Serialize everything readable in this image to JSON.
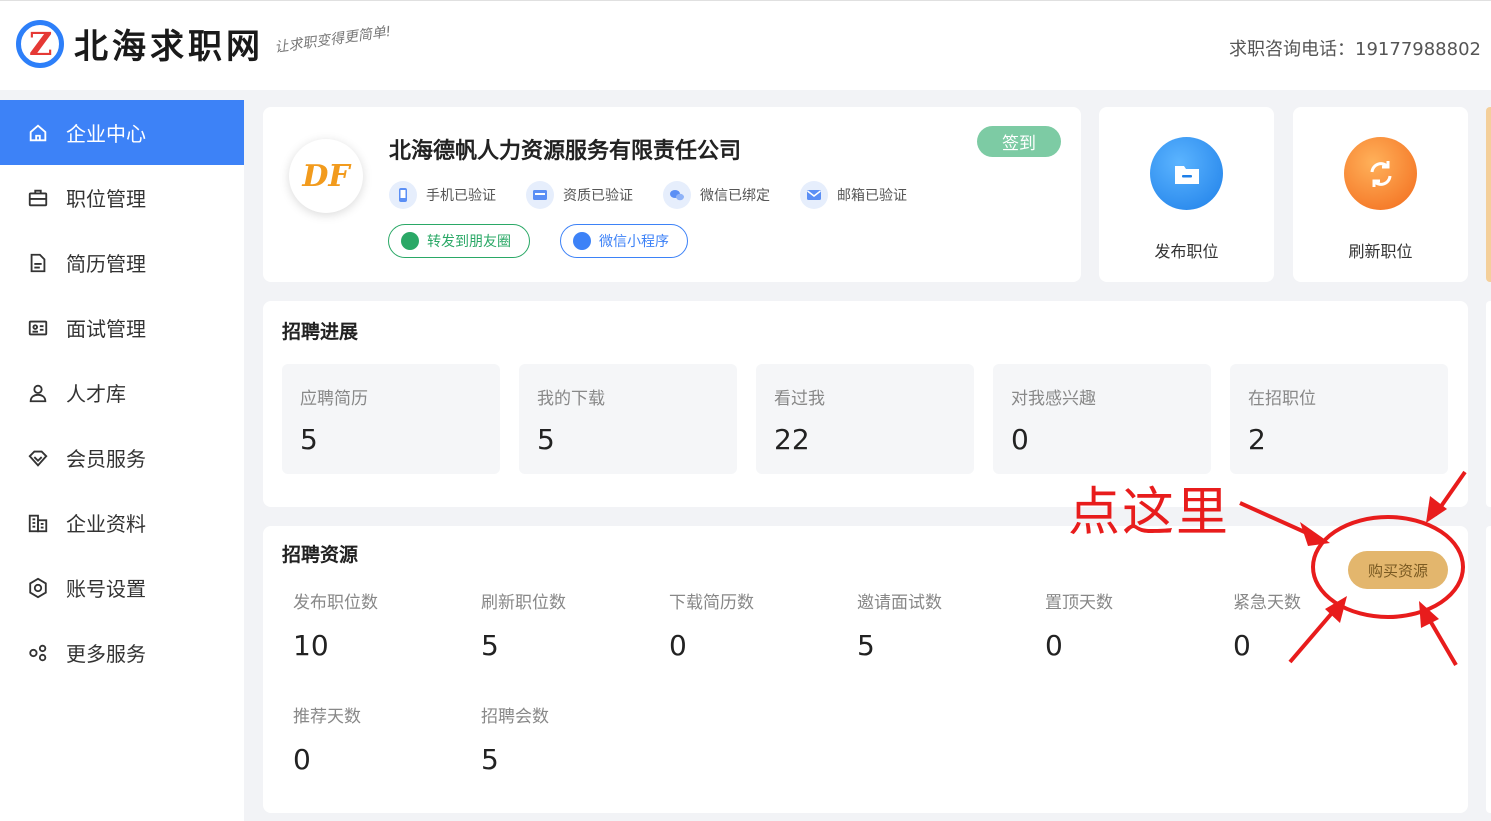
{
  "header": {
    "site_name": "北海求职网",
    "slogan": "让求职变得更简单!",
    "hotline": "求职咨询电话：19177988802"
  },
  "sidebar": {
    "items": [
      {
        "label": "企业中心",
        "icon": "home-icon",
        "active": true
      },
      {
        "label": "职位管理",
        "icon": "briefcase-icon",
        "active": false
      },
      {
        "label": "简历管理",
        "icon": "document-icon",
        "active": false
      },
      {
        "label": "面试管理",
        "icon": "id-card-icon",
        "active": false
      },
      {
        "label": "人才库",
        "icon": "user-icon",
        "active": false
      },
      {
        "label": "会员服务",
        "icon": "diamond-icon",
        "active": false
      },
      {
        "label": "企业资料",
        "icon": "building-icon",
        "active": false
      },
      {
        "label": "账号设置",
        "icon": "settings-icon",
        "active": false
      },
      {
        "label": "更多服务",
        "icon": "apps-icon",
        "active": false
      }
    ]
  },
  "company": {
    "logo_text": "DF",
    "name": "北海德帆人力资源服务有限责任公司",
    "checkin_label": "签到",
    "verifications": [
      {
        "label": "手机已验证",
        "icon": "phone-icon"
      },
      {
        "label": "资质已验证",
        "icon": "credential-icon"
      },
      {
        "label": "微信已绑定",
        "icon": "wechat-icon"
      },
      {
        "label": "邮箱已验证",
        "icon": "mail-icon"
      }
    ],
    "share_moments": "转发到朋友圈",
    "mini_program": "微信小程序"
  },
  "quick_actions": {
    "post_job": "发布职位",
    "refresh_job": "刷新职位"
  },
  "progress": {
    "title": "招聘进展",
    "stats": [
      {
        "label": "应聘简历",
        "value": "5"
      },
      {
        "label": "我的下载",
        "value": "5"
      },
      {
        "label": "看过我",
        "value": "22"
      },
      {
        "label": "对我感兴趣",
        "value": "0"
      },
      {
        "label": "在招职位",
        "value": "2"
      }
    ]
  },
  "resources": {
    "title": "招聘资源",
    "buy_label": "购买资源",
    "items": [
      {
        "label": "发布职位数",
        "value": "10"
      },
      {
        "label": "刷新职位数",
        "value": "5"
      },
      {
        "label": "下载简历数",
        "value": "0"
      },
      {
        "label": "邀请面试数",
        "value": "5"
      },
      {
        "label": "置顶天数",
        "value": "0"
      },
      {
        "label": "紧急天数",
        "value": "0"
      },
      {
        "label": "推荐天数",
        "value": "0"
      },
      {
        "label": "招聘会数",
        "value": "5"
      }
    ]
  },
  "annotation": {
    "text": "点这里",
    "color": "#e81c1c"
  },
  "colors": {
    "accent": "#3d82f7",
    "checkin": "#7dcba4",
    "buy": "#e3b66d"
  }
}
